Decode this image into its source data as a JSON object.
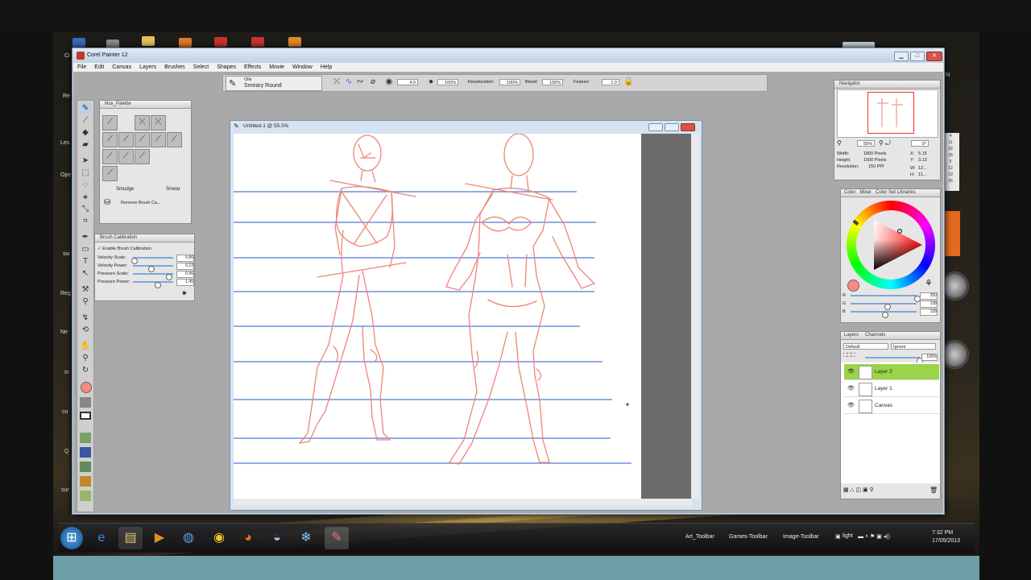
{
  "app": {
    "title": "Corel Painter 12",
    "window_buttons": {
      "minimize": "▁",
      "maximize": "□",
      "close": "✕"
    }
  },
  "menu": [
    "File",
    "Edit",
    "Canvas",
    "Layers",
    "Brushes",
    "Select",
    "Shapes",
    "Effects",
    "Movie",
    "Window",
    "Help"
  ],
  "property_bar": {
    "brush_category": "Oils",
    "brush_variant": "Smeary Round",
    "size_value": "4.0",
    "opacity_value": "100%",
    "resaturation_label": "Resaturation:",
    "resaturation_value": "100%",
    "bleed_label": "Bleed:",
    "bleed_value": "100%",
    "feature_label": "Feature:",
    "feature_value": "1.0"
  },
  "nox_palette": {
    "title": "Nox_Palette",
    "smudge_label": "Smudge",
    "smear_label": "Smear",
    "remove_label": "Remove Brush Ca..."
  },
  "brush_calibration": {
    "title": "Brush Calibration",
    "enable_label": "Enable Brush Calibration",
    "sliders": [
      {
        "label": "Velocity Scale:",
        "value": "0.86",
        "level": 0.02
      },
      {
        "label": "Velocity Power:",
        "value": "0.22",
        "level": 0.45
      },
      {
        "label": "Pressure Scale:",
        "value": "0.96",
        "level": 0.88
      },
      {
        "label": "Pressure Power:",
        "value": "1.45",
        "level": 0.6
      }
    ]
  },
  "document": {
    "title": "Untitled-1 @ 55.5%"
  },
  "navigator": {
    "title": "Navigator",
    "zoom": "55%",
    "rotation": "0°",
    "width_label": "Width:",
    "width_value": "1800 Pixels",
    "height_label": "Height:",
    "height_value": "1500 Pixels",
    "resolution_label": "Resolution:",
    "resolution_value": "150 PPI",
    "x_label": "X:",
    "x_value": "5.15",
    "y_label": "Y:",
    "y_value": "3.13",
    "w_label": "W:",
    "w_value": "12...",
    "h_label": "H:",
    "h_value": "11..."
  },
  "color_panel": {
    "tabs": [
      "Color",
      "Mixer",
      "Color Set Libraries"
    ],
    "rgb": [
      {
        "label": "R",
        "value": "250"
      },
      {
        "label": "G",
        "value": "138"
      },
      {
        "label": "B",
        "value": "128"
      }
    ],
    "current_color": "#fa8a80"
  },
  "layers_panel": {
    "tabs": [
      "Layers",
      "Channels"
    ],
    "composite_method": "Default",
    "composite_depth": "Ignore",
    "opacity": "100%",
    "layers": [
      {
        "name": "Layer 2",
        "selected": true
      },
      {
        "name": "Layer 1",
        "selected": false
      },
      {
        "name": "Canvas",
        "selected": false
      }
    ]
  },
  "taskbar": {
    "toolbars": [
      "Art_Toolbar",
      "Games-Toolbar",
      "Image-Toolbar"
    ],
    "light_label": "light",
    "time": "7:32 PM",
    "date": "17/05/2013"
  },
  "desktop_fragments": [
    "Re",
    "Les",
    "Ope",
    "sw",
    "Reg",
    "Ne",
    "In",
    "co",
    "Q",
    "sur",
    "Ci",
    "N"
  ],
  "calendar_numbers": [
    "4",
    "11",
    "18",
    "25",
    "5",
    "12",
    "19",
    "26"
  ],
  "colors": {
    "sketch_line": "#ee8577",
    "guide_line": "#6f8fdf",
    "layer_selected": "#9bd34a"
  }
}
